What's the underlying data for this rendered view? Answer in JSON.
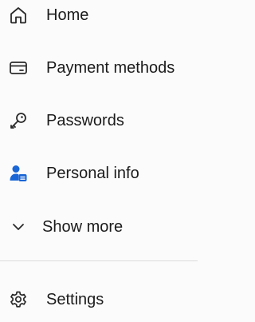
{
  "nav": {
    "items": [
      {
        "label": "Home",
        "icon": "home-icon"
      },
      {
        "label": "Payment methods",
        "icon": "credit-card-icon"
      },
      {
        "label": "Passwords",
        "icon": "key-icon"
      },
      {
        "label": "Personal info",
        "icon": "person-card-icon"
      }
    ],
    "show_more": {
      "label": "Show more",
      "icon": "chevron-down-icon"
    },
    "settings": {
      "label": "Settings",
      "icon": "gear-icon"
    }
  },
  "colors": {
    "accent": "#1a66d6",
    "text": "#1b1b1b",
    "background": "#fbfbfb",
    "divider": "#dcdcdc"
  }
}
